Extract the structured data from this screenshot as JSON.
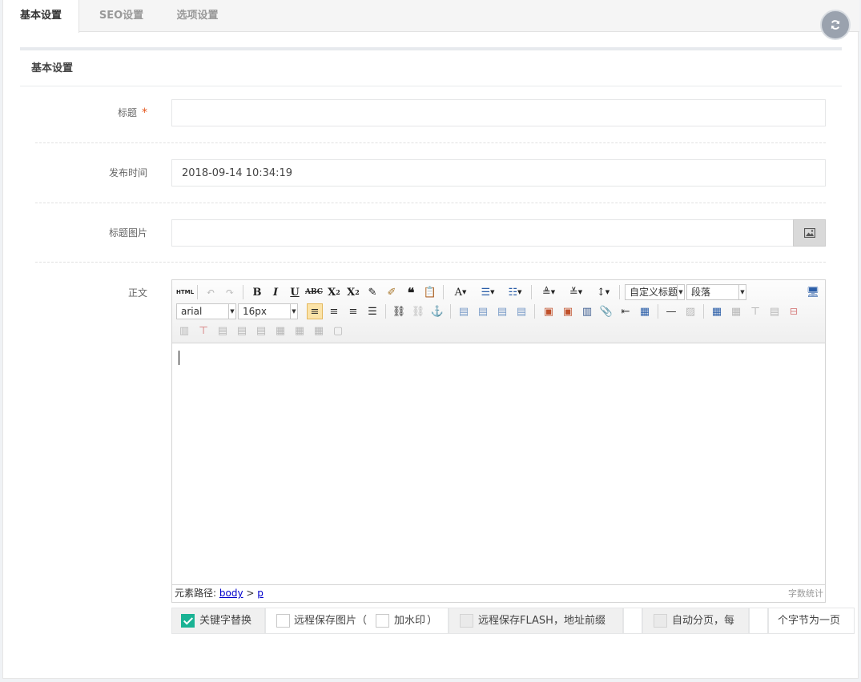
{
  "tabs": [
    {
      "label": "基本设置",
      "active": true
    },
    {
      "label": "SEO设置",
      "active": false
    },
    {
      "label": "选项设置",
      "active": false
    }
  ],
  "panel": {
    "title": "基本设置"
  },
  "form": {
    "title_label": "标题",
    "required_mark": "*",
    "title_value": "",
    "pubtime_label": "发布时间",
    "pubtime_value": "2018-09-14 10:34:19",
    "titleimg_label": "标题图片",
    "titleimg_value": "",
    "body_label": "正文"
  },
  "editor": {
    "html_btn": "HTML",
    "heading_combo": "自定义标题",
    "paragraph_combo": "段落",
    "font_combo": "arial",
    "size_combo": "16px",
    "path_label": "元素路径:",
    "path_body": "body",
    "path_sep": ">",
    "path_p": "p",
    "word_count": "字数统计"
  },
  "options": {
    "keyword_replace": "关键字替换",
    "remote_save_img": "远程保存图片（",
    "watermark": "加水印",
    "close_paren": "）",
    "remote_save_flash": "远程保存FLASH，地址前缀",
    "auto_page": "自动分页，每",
    "chars_per_page": "个字节为一页"
  },
  "colors": {
    "accent": "#1ab394",
    "required": "#e5561c"
  }
}
